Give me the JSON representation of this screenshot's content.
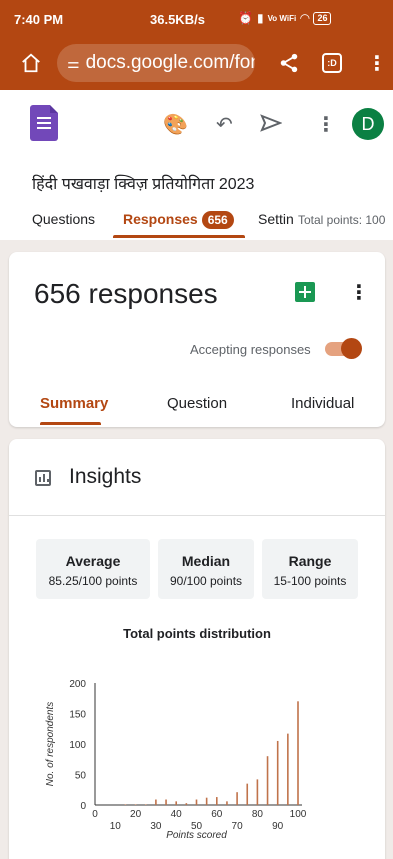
{
  "status_bar": {
    "time": "7:40 PM",
    "network_speed": "36.5KB/s",
    "network": "Vo WiFi",
    "battery": "26"
  },
  "browser": {
    "url": "docs.google.com/for"
  },
  "form": {
    "title": "हिंदी पखवाड़ा  क्विज़ प्रतियोगिता 2023",
    "avatar_letter": "D",
    "tabs": [
      {
        "label": "Questions"
      },
      {
        "label": "Responses",
        "badge": "656"
      },
      {
        "label": "Settin"
      }
    ],
    "total_points": "Total points: 100"
  },
  "responses": {
    "count_label": "656 responses",
    "accepting_label": "Accepting responses",
    "accepting": true,
    "subtabs": [
      "Summary",
      "Question",
      "Individual"
    ]
  },
  "insights": {
    "title": "Insights",
    "stats": [
      {
        "label": "Average",
        "value": "85.25/100 points"
      },
      {
        "label": "Median",
        "value": "90/100 points"
      },
      {
        "label": "Range",
        "value": "15-100 points"
      }
    ]
  },
  "colors": {
    "accent": "#b34712",
    "bar": "#c0734b",
    "sheets_green": "#1a9853",
    "avatar_green": "#0b8043",
    "forms_purple": "#7248b9"
  },
  "chart_data": {
    "type": "bar",
    "title": "Total points distribution",
    "xlabel": "Points scored",
    "ylabel": "No. of respondents",
    "ylim": [
      0,
      200
    ],
    "yticks": [
      0,
      50,
      100,
      150,
      200
    ],
    "xticks_top": [
      "0",
      "20",
      "40",
      "60",
      "80",
      "100"
    ],
    "xticks_bottom": [
      "10",
      "30",
      "50",
      "70",
      "90"
    ],
    "x": [
      15,
      20,
      25,
      30,
      35,
      40,
      45,
      50,
      55,
      60,
      65,
      70,
      75,
      80,
      85,
      90,
      95,
      100
    ],
    "values": [
      1,
      1,
      1,
      9,
      9,
      6,
      3,
      9,
      12,
      13,
      6,
      21,
      35,
      42,
      80,
      105,
      117,
      170
    ]
  }
}
